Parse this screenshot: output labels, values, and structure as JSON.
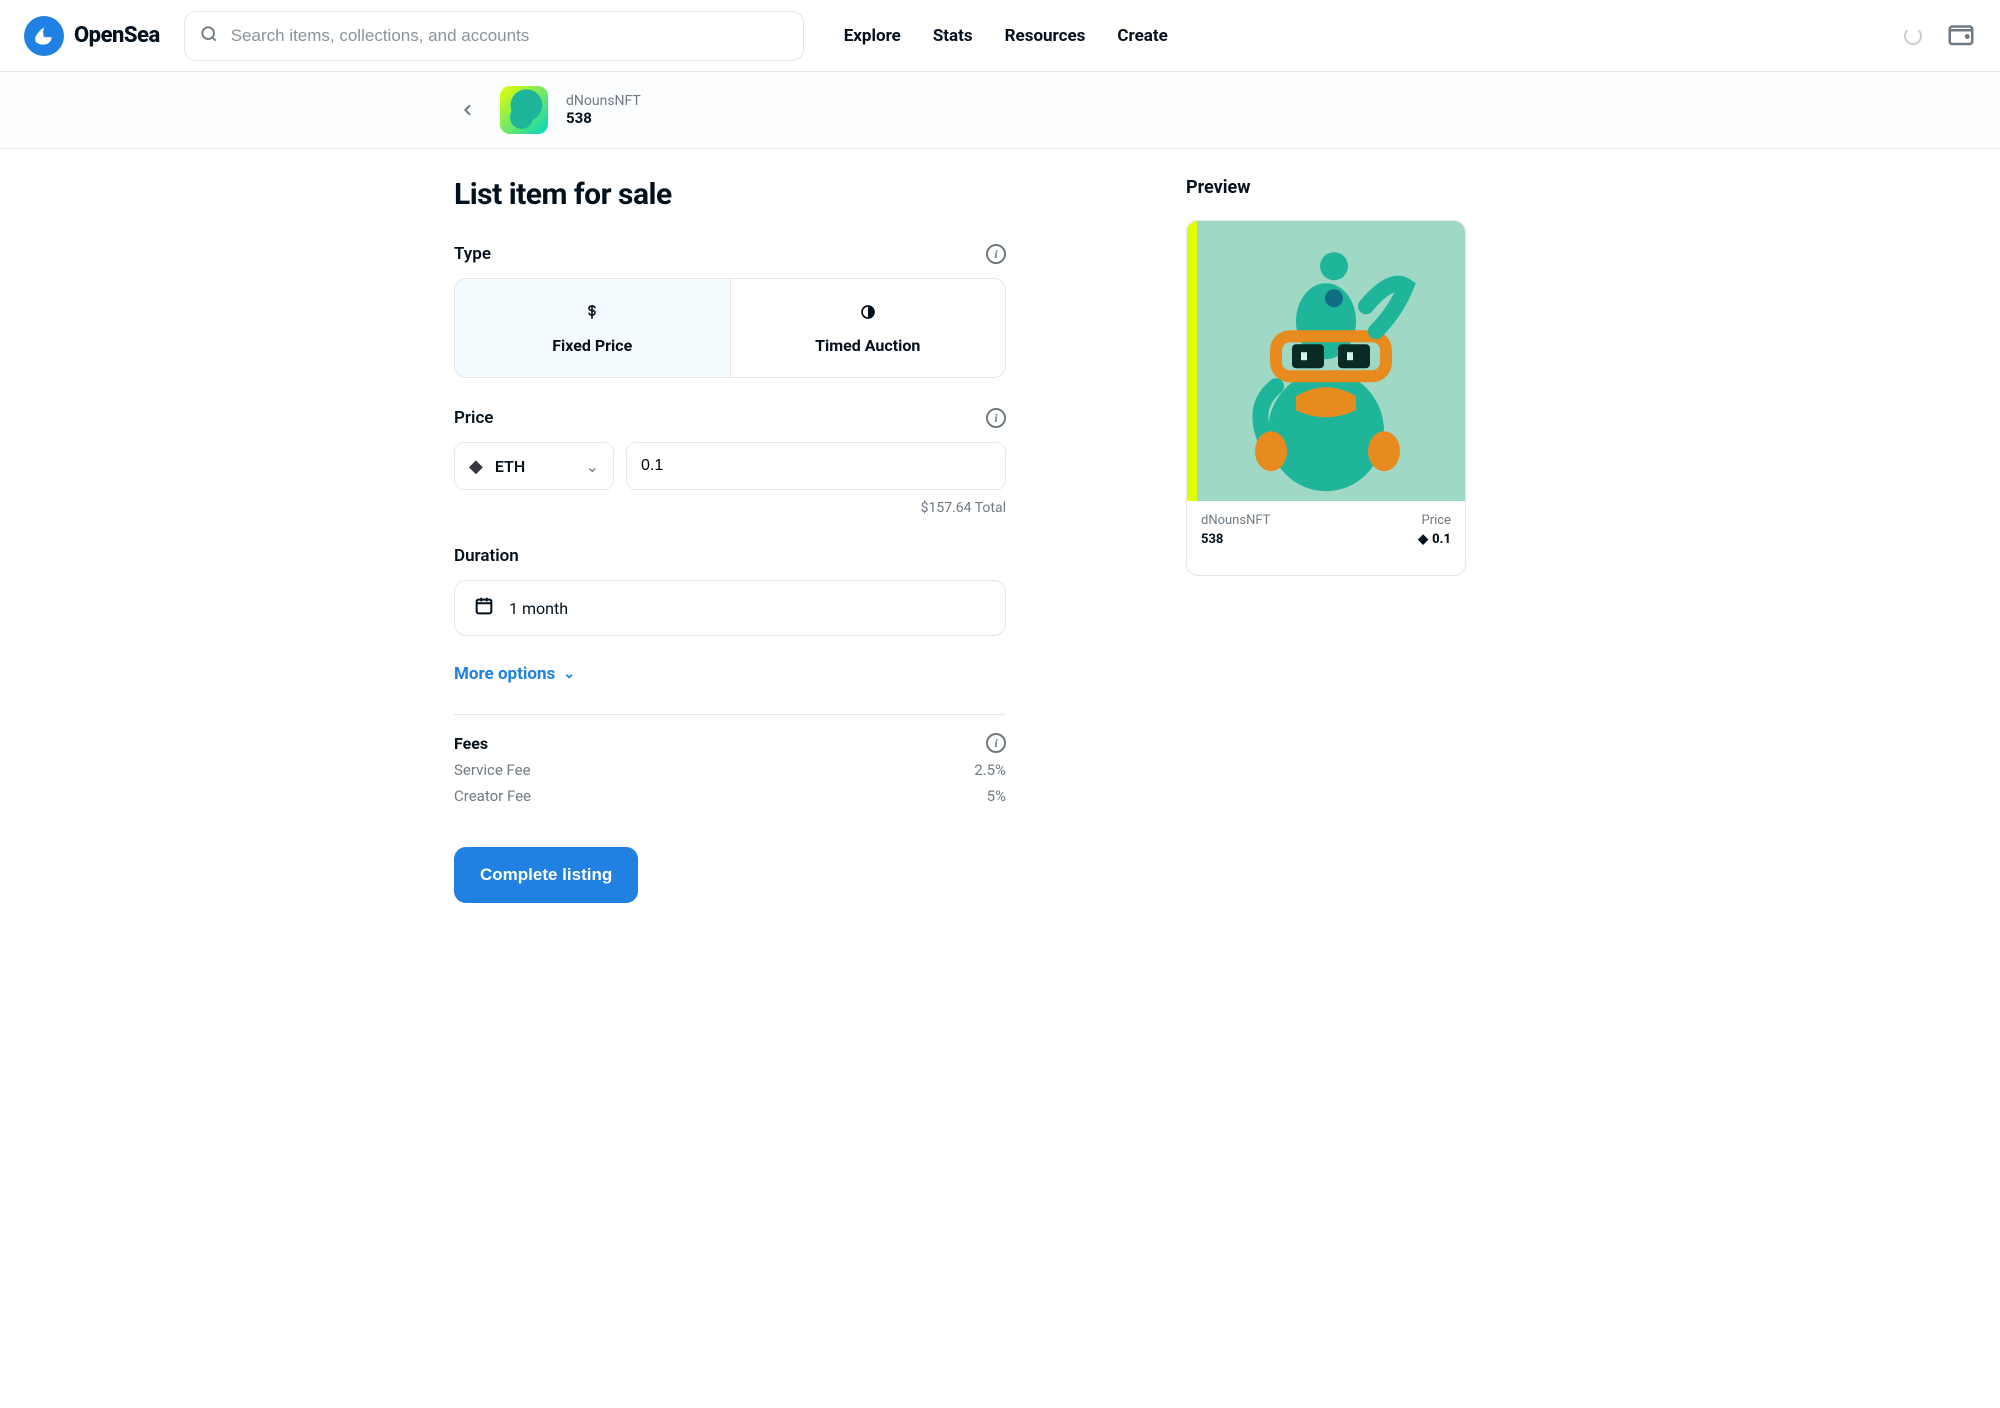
{
  "brand": "OpenSea",
  "search": {
    "placeholder": "Search items, collections, and accounts"
  },
  "nav": {
    "explore": "Explore",
    "stats": "Stats",
    "resources": "Resources",
    "create": "Create"
  },
  "item": {
    "collection": "dNounsNFT",
    "token_id": "538"
  },
  "page_title": "List item for sale",
  "form": {
    "type_label": "Type",
    "type_fixed": "Fixed Price",
    "type_auction": "Timed Auction",
    "price_label": "Price",
    "currency_symbol": "ETH",
    "amount": "0.1",
    "usd_total": "$157.64 Total",
    "duration_label": "Duration",
    "duration_value": "1 month",
    "more_options": "More options",
    "fees_label": "Fees",
    "fees": {
      "service_label": "Service Fee",
      "service_value": "2.5%",
      "creator_label": "Creator Fee",
      "creator_value": "5%"
    },
    "cta": "Complete listing"
  },
  "preview": {
    "title": "Preview",
    "collection": "dNounsNFT",
    "token_id": "538",
    "price_label": "Price",
    "price_value": "0.1"
  }
}
